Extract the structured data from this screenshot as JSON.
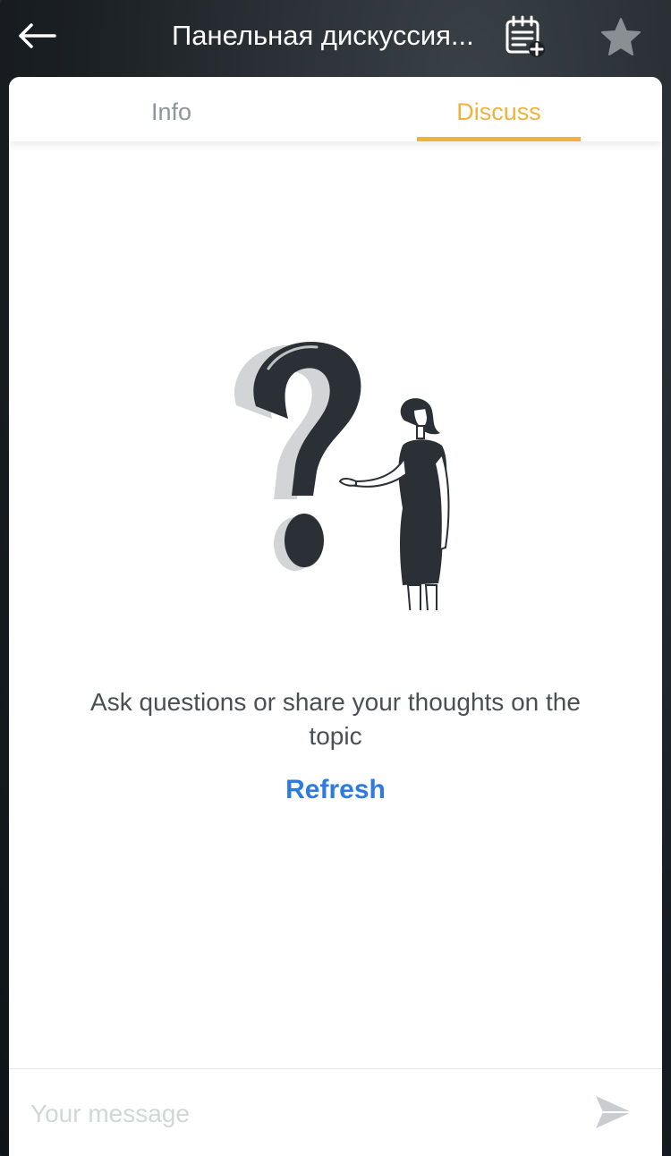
{
  "header": {
    "title": "Панельная дискуссия...",
    "back_icon": "arrow-left-icon",
    "calendar_icon": "calendar-add-icon",
    "star_icon": "star-icon"
  },
  "tabs": [
    {
      "label": "Info",
      "active": false
    },
    {
      "label": "Discuss",
      "active": true
    }
  ],
  "empty_state": {
    "illustration": "question-mark-woman-illustration",
    "message": "Ask questions or share your thoughts on the topic",
    "refresh_label": "Refresh"
  },
  "composer": {
    "placeholder": "Your message",
    "value": "",
    "send_icon": "send-icon"
  },
  "colors": {
    "accent": "#efb33d",
    "link": "#2e7be0",
    "inactive_tab": "#8e9499",
    "header_bg": "#1c2227"
  }
}
